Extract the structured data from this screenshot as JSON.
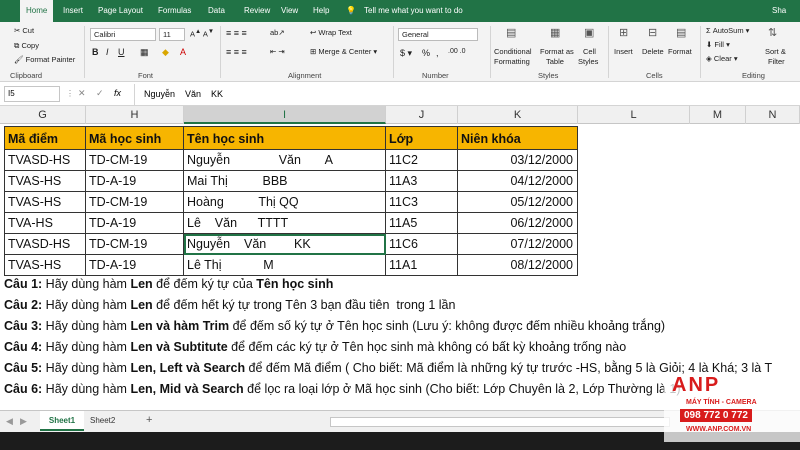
{
  "menu": {
    "tabs": [
      "Home",
      "Insert",
      "Page Layout",
      "Formulas",
      "Data",
      "Review",
      "View",
      "Help"
    ],
    "tell_me": "Tell me what you want to do",
    "share": "Sha"
  },
  "ribbon": {
    "clipboard": {
      "cut": "Cut",
      "copy": "Copy",
      "format_painter": "Format Painter",
      "label": "Clipboard"
    },
    "font": {
      "name": "Calibri",
      "size": "11",
      "label": "Font",
      "bold": "B",
      "italic": "I",
      "underline": "U"
    },
    "alignment": {
      "wrap_text": "Wrap Text",
      "merge_center": "Merge & Center",
      "label": "Alignment"
    },
    "number": {
      "format": "General",
      "label": "Number",
      "percent": "%",
      "comma": ","
    },
    "styles": {
      "conditional": "Conditional",
      "conditional2": "Formatting",
      "format_as": "Format as",
      "format_as2": "Table",
      "cell": "Cell",
      "cell2": "Styles",
      "label": "Styles"
    },
    "cells": {
      "insert": "Insert",
      "delete": "Delete",
      "format": "Format",
      "label": "Cells"
    },
    "editing": {
      "autosum": "AutoSum",
      "fill": "Fill",
      "clear": "Clear",
      "sort": "Sort &",
      "sort2": "Filter",
      "label": "Editing"
    }
  },
  "formula_bar": {
    "cell_ref": "I5",
    "fx": "fx",
    "value": "Nguyễn    Văn    KK"
  },
  "columns": [
    "G",
    "H",
    "I",
    "J",
    "K",
    "L",
    "M",
    "N"
  ],
  "table": {
    "headers": [
      "Mã điểm",
      "Mã học sinh",
      "Tên học sinh",
      "Lớp",
      "Niên khóa"
    ],
    "rows": [
      [
        "TVASD-HS",
        "TD-CM-19",
        "Nguyễn              Văn       A",
        "11C2",
        "03/12/2000"
      ],
      [
        "TVAS-HS",
        "TD-A-19",
        "Mai Thị          BBB",
        "11A3",
        "04/12/2000"
      ],
      [
        "TVAS-HS",
        "TD-CM-19",
        "Hoàng          Thị QQ",
        "11C3",
        "05/12/2000"
      ],
      [
        "TVA-HS",
        "TD-A-19",
        "Lê    Văn      TTTT",
        "11A5",
        "06/12/2000"
      ],
      [
        "TVASD-HS",
        "TD-CM-19",
        "Nguyễn    Văn        KK",
        "11C6",
        "07/12/2000"
      ],
      [
        "TVAS-HS",
        "TD-A-19",
        "Lê Thị            M",
        "11A1",
        "08/12/2000"
      ]
    ]
  },
  "questions": [
    {
      "num": "Câu 1:",
      "pre": " Hãy dùng hàm ",
      "fn": "Len",
      "post": " để đếm ký tự của ",
      "tail_bold": "Tên học sinh",
      "tail": ""
    },
    {
      "num": "Câu 2:",
      "pre": " Hãy dùng hàm ",
      "fn": "Len",
      "post": " để đếm hết ký tự trong Tên 3 bạn đầu tiên  trong 1 lần",
      "tail_bold": "",
      "tail": ""
    },
    {
      "num": "Câu 3:",
      "pre": " Hãy dùng hàm ",
      "fn": "Len và hàm Trim",
      "post": " để đếm số ký tự ở Tên học sinh (Lưu ý: không được đếm nhiều khoảng trắng)",
      "tail_bold": "",
      "tail": ""
    },
    {
      "num": "Câu 4:",
      "pre": " Hãy dùng hàm ",
      "fn": "Len và Subtitute",
      "post": " để đếm các ký tự ở Tên học sinh mà không có bất kỳ khoảng trống nào",
      "tail_bold": "",
      "tail": ""
    },
    {
      "num": "Câu 5:",
      "pre": " Hãy dùng hàm ",
      "fn": "Len, Left và Search",
      "post": " để đếm Mã điểm ( Cho biết: Mã điểm là những ký tự trước -HS, bằng 5 là Giỏi; 4 là Khá; 3 là T",
      "tail_bold": "",
      "tail": ""
    },
    {
      "num": "Câu 6:",
      "pre": " Hãy dùng hàm ",
      "fn": "Len, Mid và Search",
      "post": " để lọc ra loại lớp ở Mã học sinh (Cho biết: Lớp Chuyên là 2, Lớp Thường là 1)",
      "tail_bold": "",
      "tail": ""
    }
  ],
  "sheets": {
    "active": "Sheet1",
    "other": "Sheet2",
    "add": "+"
  },
  "watermark": {
    "brand": "ANP",
    "sub": "MÁY TÍNH - CAMERA",
    "phone": "098 772 0 772",
    "url": "WWW.ANP.COM.VN"
  }
}
